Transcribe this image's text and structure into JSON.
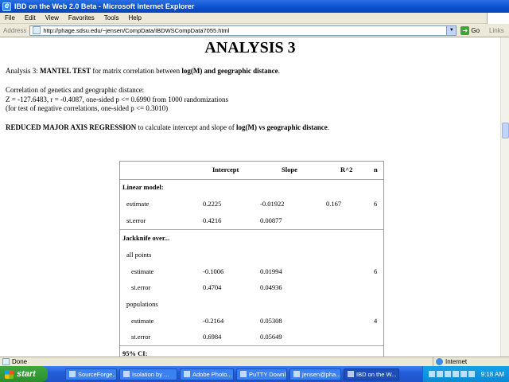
{
  "window": {
    "title": "IBD on the Web 2.0 Beta - Microsoft Internet Explorer"
  },
  "menu": [
    "File",
    "Edit",
    "View",
    "Favorites",
    "Tools",
    "Help"
  ],
  "address": {
    "label": "Address",
    "url": "http://phage.sdsu.edu/~jensen/CompData/IBDWSCompData7055.html",
    "go": "Go",
    "links": "Links"
  },
  "page": {
    "heading": "ANALYSIS 3",
    "intro": {
      "pre": "Analysis 3: ",
      "b1": "MANTEL TEST",
      "mid": " for matrix correlation between ",
      "b2": "log(M) and geographic distance",
      "post": "."
    },
    "corr_title": "Correlation of genetics and geographic distance:",
    "corr_line1": "Z = -127.6483, r = -0.4087, one-sided p <= 0.6990 from 1000 randomizations",
    "corr_line2": "(for test of negative correlations, one-sided p <= 0.3010)",
    "rma": {
      "b1": "REDUCED MAJOR AXIS REGRESSION",
      "mid": " to calculate intercept and slope of ",
      "b2": "log(M) vs geographic distance",
      "post": "."
    },
    "table": {
      "headers": {
        "intercept": "Intercept",
        "slope": "Slope",
        "r2": "R^2",
        "n": "n"
      },
      "linear_model": "Linear model:",
      "lm_estimate": {
        "label": "estimate",
        "intercept": "0.2225",
        "slope": "-0.01922",
        "r2": "0.167",
        "n": "6"
      },
      "lm_sterror": {
        "label": "st.error",
        "intercept": "0.4216",
        "slope": "0.00877"
      },
      "jackknife": "Jackknife over...",
      "all_points": "all points",
      "ap_estimate": {
        "label": "estimate",
        "intercept": "-0.1006",
        "slope": "0.01994",
        "n": "6"
      },
      "ap_sterror": {
        "label": "st.error",
        "intercept": "0.4704",
        "slope": "0.04936"
      },
      "populations": "populations",
      "pop_estimate": {
        "label": "estimate",
        "intercept": "-0.2164",
        "slope": "0.05308",
        "n": "4"
      },
      "pop_sterror": {
        "label": "st.error",
        "intercept": "0.6984",
        "slope": "0.05649"
      },
      "ci": "95% CI:"
    }
  },
  "status": {
    "text": "Done",
    "zone": "Internet"
  },
  "taskbar": {
    "start": "start",
    "tasks": [
      "SourceForge...",
      "Isolation by ...",
      "Adobe Photo...",
      "PuTTY Downl...",
      "jensen@pha...",
      "IBD on the W..."
    ],
    "clock": "9:18 AM"
  }
}
